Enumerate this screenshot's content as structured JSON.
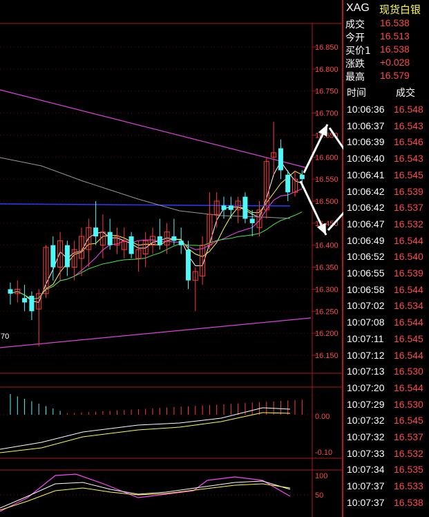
{
  "quote": {
    "symbol": "XAG",
    "name": "现货白银",
    "rows": [
      {
        "label": "成交",
        "value": "16.538"
      },
      {
        "label": "今开",
        "value": "16.513"
      },
      {
        "label": "买价1",
        "value": "16.538"
      },
      {
        "label": "涨跌",
        "value": "+0.028"
      },
      {
        "label": "最高",
        "value": "16.579"
      }
    ]
  },
  "trades": {
    "headers": {
      "time": "时间",
      "price": "成交"
    },
    "rows": [
      {
        "time": "10:06:36",
        "price": "16.548"
      },
      {
        "time": "10:06:37",
        "price": "16.543"
      },
      {
        "time": "10:06:39",
        "price": "16.546"
      },
      {
        "time": "10:06:40",
        "price": "16.543"
      },
      {
        "time": "10:06:41",
        "price": "16.545"
      },
      {
        "time": "10:06:42",
        "price": "16.539"
      },
      {
        "time": "10:06:42",
        "price": "16.537"
      },
      {
        "time": "10:06:47",
        "price": "16.532"
      },
      {
        "time": "10:06:49",
        "price": "16.544"
      },
      {
        "time": "10:06:52",
        "price": "16.540"
      },
      {
        "time": "10:06:55",
        "price": "16.539"
      },
      {
        "time": "10:06:58",
        "price": "16.544"
      },
      {
        "time": "10:07:02",
        "price": "16.534"
      },
      {
        "time": "10:07:08",
        "price": "16.544"
      },
      {
        "time": "10:07:11",
        "price": "16.545"
      },
      {
        "time": "10:07:12",
        "price": "16.544"
      },
      {
        "time": "10:07:13",
        "price": "16.530"
      },
      {
        "time": "10:07:20",
        "price": "16.544"
      },
      {
        "time": "10:07:29",
        "price": "16.530"
      },
      {
        "time": "10:07:32",
        "price": "16.545"
      },
      {
        "time": "10:07:32",
        "price": "16.537"
      },
      {
        "time": "10:07:33",
        "price": "16.532"
      },
      {
        "time": "10:07:34",
        "price": "16.535"
      },
      {
        "time": "10:07:37",
        "price": "16.533"
      },
      {
        "time": "10:07:37",
        "price": "16.538"
      }
    ]
  },
  "chart_data": {
    "type": "candlestick",
    "ylim": [
      16.12,
      16.9
    ],
    "yticks": [
      "16.850",
      "16.800",
      "16.750",
      "16.700",
      "16.650",
      "16.600",
      "16.550",
      "16.500",
      "16.450",
      "16.400",
      "16.350",
      "16.300",
      "16.250",
      "16.200",
      "16.150"
    ],
    "label_left": "70",
    "candles": [
      {
        "o": 16.3,
        "h": 16.315,
        "l": 16.265,
        "c": 16.29
      },
      {
        "o": 16.29,
        "h": 16.32,
        "l": 16.27,
        "c": 16.3
      },
      {
        "o": 16.28,
        "h": 16.31,
        "l": 16.25,
        "c": 16.27
      },
      {
        "o": 16.285,
        "h": 16.295,
        "l": 16.23,
        "c": 16.25
      },
      {
        "o": 16.255,
        "h": 16.3,
        "l": 16.17,
        "c": 16.29
      },
      {
        "o": 16.29,
        "h": 16.4,
        "l": 16.28,
        "c": 16.395
      },
      {
        "o": 16.4,
        "h": 16.42,
        "l": 16.32,
        "c": 16.35
      },
      {
        "o": 16.35,
        "h": 16.43,
        "l": 16.32,
        "c": 16.41
      },
      {
        "o": 16.4,
        "h": 16.41,
        "l": 16.33,
        "c": 16.35
      },
      {
        "o": 16.35,
        "h": 16.41,
        "l": 16.32,
        "c": 16.39
      },
      {
        "o": 16.37,
        "h": 16.44,
        "l": 16.33,
        "c": 16.42
      },
      {
        "o": 16.39,
        "h": 16.46,
        "l": 16.35,
        "c": 16.44
      },
      {
        "o": 16.44,
        "h": 16.5,
        "l": 16.4,
        "c": 16.42
      },
      {
        "o": 16.4,
        "h": 16.47,
        "l": 16.37,
        "c": 16.43
      },
      {
        "o": 16.43,
        "h": 16.46,
        "l": 16.39,
        "c": 16.4
      },
      {
        "o": 16.4,
        "h": 16.44,
        "l": 16.38,
        "c": 16.42
      },
      {
        "o": 16.39,
        "h": 16.44,
        "l": 16.37,
        "c": 16.41
      },
      {
        "o": 16.42,
        "h": 16.43,
        "l": 16.37,
        "c": 16.38
      },
      {
        "o": 16.37,
        "h": 16.41,
        "l": 16.34,
        "c": 16.39
      },
      {
        "o": 16.38,
        "h": 16.43,
        "l": 16.35,
        "c": 16.41
      },
      {
        "o": 16.4,
        "h": 16.44,
        "l": 16.38,
        "c": 16.42
      },
      {
        "o": 16.42,
        "h": 16.46,
        "l": 16.39,
        "c": 16.4
      },
      {
        "o": 16.4,
        "h": 16.45,
        "l": 16.38,
        "c": 16.43
      },
      {
        "o": 16.42,
        "h": 16.46,
        "l": 16.4,
        "c": 16.41
      },
      {
        "o": 16.41,
        "h": 16.44,
        "l": 16.38,
        "c": 16.4
      },
      {
        "o": 16.39,
        "h": 16.41,
        "l": 16.3,
        "c": 16.32
      },
      {
        "o": 16.32,
        "h": 16.35,
        "l": 16.25,
        "c": 16.34
      },
      {
        "o": 16.33,
        "h": 16.42,
        "l": 16.31,
        "c": 16.4
      },
      {
        "o": 16.4,
        "h": 16.52,
        "l": 16.39,
        "c": 16.47
      },
      {
        "o": 16.47,
        "h": 16.52,
        "l": 16.44,
        "c": 16.5
      },
      {
        "o": 16.49,
        "h": 16.51,
        "l": 16.46,
        "c": 16.48
      },
      {
        "o": 16.49,
        "h": 16.51,
        "l": 16.46,
        "c": 16.48
      },
      {
        "o": 16.48,
        "h": 16.51,
        "l": 16.45,
        "c": 16.5
      },
      {
        "o": 16.51,
        "h": 16.52,
        "l": 16.45,
        "c": 16.46
      },
      {
        "o": 16.46,
        "h": 16.48,
        "l": 16.42,
        "c": 16.45
      },
      {
        "o": 16.44,
        "h": 16.5,
        "l": 16.42,
        "c": 16.48
      },
      {
        "o": 16.48,
        "h": 16.6,
        "l": 16.46,
        "c": 16.59
      },
      {
        "o": 16.6,
        "h": 16.68,
        "l": 16.56,
        "c": 16.61
      },
      {
        "o": 16.62,
        "h": 16.64,
        "l": 16.55,
        "c": 16.57
      },
      {
        "o": 16.56,
        "h": 16.57,
        "l": 16.5,
        "c": 16.52
      },
      {
        "o": 16.52,
        "h": 16.57,
        "l": 16.51,
        "c": 16.55
      },
      {
        "o": 16.56,
        "h": 16.57,
        "l": 16.53,
        "c": 16.55
      }
    ]
  }
}
